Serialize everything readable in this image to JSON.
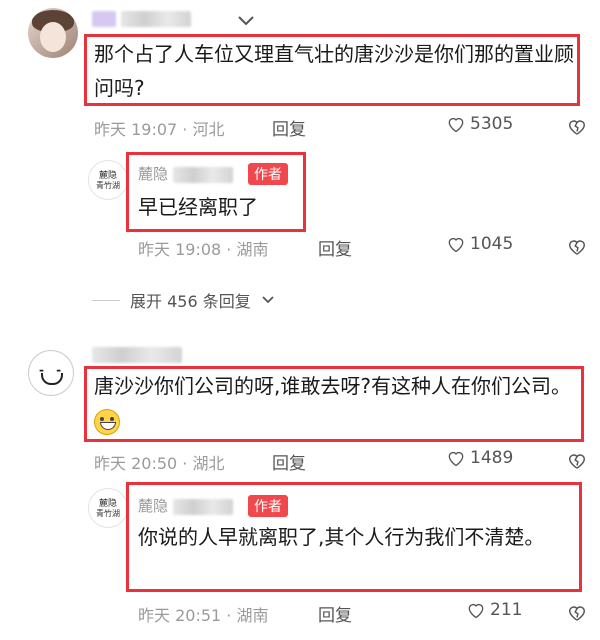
{
  "comments": [
    {
      "username_prefix": "",
      "text": "那个占了人车位又理直气壮的唐沙沙是你们那的置业顾问吗?",
      "time": "昨天 19:07",
      "separator": "·",
      "location": "河北",
      "reply_label": "回复",
      "likes": "5305"
    },
    {
      "username_prefix": "麓隐",
      "author_badge": "作者",
      "avatar_logo": [
        "麓隐",
        "青竹湖"
      ],
      "text": "早已经离职了",
      "time": "昨天 19:08",
      "separator": "·",
      "location": "湖南",
      "reply_label": "回复",
      "likes": "1045"
    },
    {
      "username_prefix": "",
      "text": "唐沙沙你们公司的呀,谁敢去呀?有这种人在你们公司。",
      "time": "昨天 20:50",
      "separator": "·",
      "location": "湖北",
      "reply_label": "回复",
      "likes": "1489"
    },
    {
      "username_prefix": "麓隐",
      "author_badge": "作者",
      "avatar_logo": [
        "麓隐",
        "青竹湖"
      ],
      "text": "你说的人早就离职了,其个人行为我们不清楚。",
      "time": "昨天 20:51",
      "separator": "·",
      "location": "湖南",
      "reply_label": "回复",
      "likes": "211"
    }
  ],
  "expand_replies": {
    "label": "展开 456 条回复"
  },
  "colors": {
    "highlight_box": "#e8333d",
    "author_badge": "#f0484d",
    "meta_text": "#9b9b9b"
  },
  "icons": [
    "heart-outline-icon",
    "heart-broken-icon",
    "chevron-down-icon",
    "grin-emoji-icon"
  ]
}
